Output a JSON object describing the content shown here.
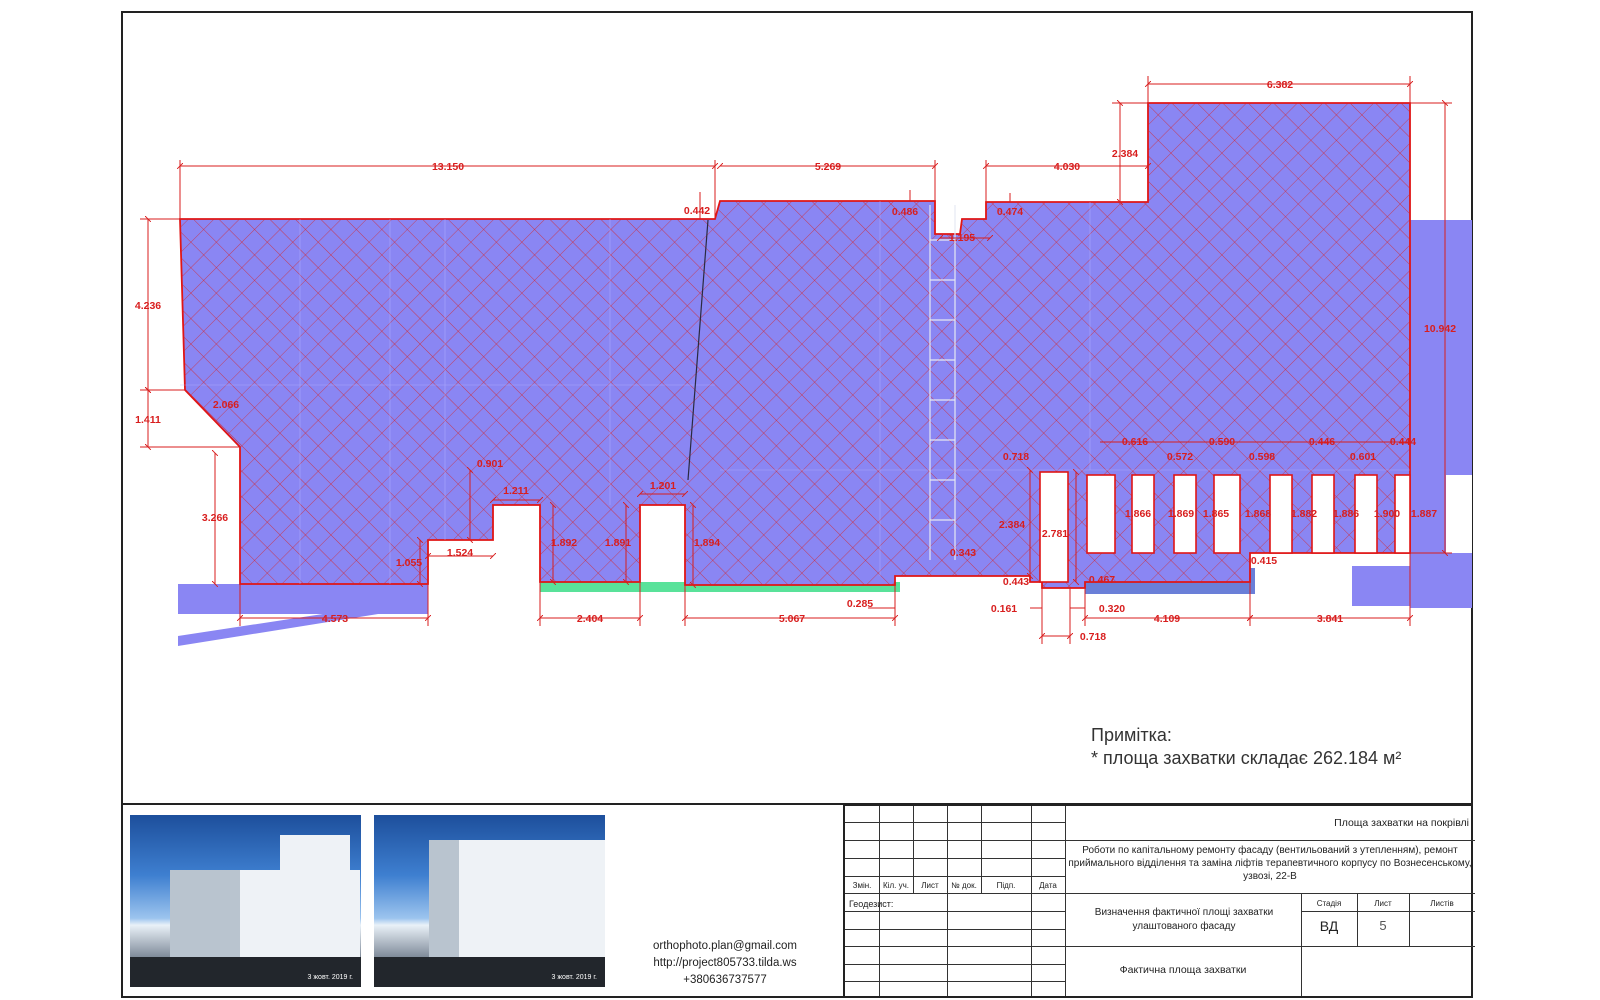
{
  "dimensions": {
    "top_13150": "13.150",
    "top_5269": "5.269",
    "top_4030": "4.030",
    "top_6382": "6.382",
    "v_2384_top": "2.384",
    "v_10942": "10.942",
    "v_4236": "4.236",
    "v_1411": "1.411",
    "diag_2066": "2.066",
    "v_3266": "3.266",
    "d_0442": "0.442",
    "d_0486": "0.486",
    "d_0474": "0.474",
    "d_1195": "1.195",
    "d_0901": "0.901",
    "d_1211": "1.211",
    "d_1201": "1.201",
    "d_1524": "1.524",
    "d_1055": "1.055",
    "d_1892": "1.892",
    "d_1891": "1.891",
    "d_1894": "1.894",
    "d_0343": "0.343",
    "d_0718_a": "0.718",
    "d_2384_mid": "2.384",
    "d_2781": "2.781",
    "d_0616": "0.616",
    "d_0572": "0.572",
    "d_0590": "0.590",
    "d_0598": "0.598",
    "d_0446": "0.446",
    "d_0601": "0.601",
    "d_0444": "0.444",
    "d_1866": "1.866",
    "d_1869": "1.869",
    "d_1865": "1.865",
    "d_1868": "1.868",
    "d_1882": "1.882",
    "d_1886": "1.886",
    "d_1900": "1.900",
    "d_1887": "1.887",
    "d_0415": "0.415",
    "d_0443": "0.443",
    "d_0467": "0.467",
    "b_4573": "4.573",
    "b_2404": "2.404",
    "b_5067": "5.067",
    "b_0285": "0.285",
    "b_0161": "0.161",
    "b_0320": "0.320",
    "b_4109": "4.109",
    "b_3841": "3.841",
    "b_0718": "0.718"
  },
  "note": {
    "heading": "Примітка:",
    "text": "* площа захватки складає 262.184 м²"
  },
  "photos": {
    "stamp_1": "3 жовт. 2019 г.",
    "stamp_2": "3 жовт. 2019 г."
  },
  "contacts": {
    "email": "orthophoto.plan@gmail.com",
    "site": "http://project805733.tilda.ws",
    "phone": "+380636737577"
  },
  "title_block": {
    "header": "Площа захватки на покрівлі",
    "project": "Роботи по капітальному ремонту фасаду (вентильований з утепленням), ремонт приймального відділення та заміна ліфтів терапевтичного корпусу по Вознесенському, узвозі, 22-В",
    "cols": [
      "Змін.",
      "Кіл. уч.",
      "Лист",
      "№ док.",
      "Підп.",
      "Дата"
    ],
    "geodesist": "Геодезист:",
    "subtitle": "Визначення фактичної площі захватки улаштованого фасаду",
    "stage_label": "Стадія",
    "sheet_label": "Лист",
    "sheets_label": "Листів",
    "stage": "ВД",
    "sheet": "5",
    "sheets": "",
    "drawing_name": "Фактична площа захватки"
  },
  "colors": {
    "facade": "#8a86f3",
    "hatch": "#d81e1e",
    "dimension": "#d81e1e",
    "ground": "#59e29a"
  }
}
